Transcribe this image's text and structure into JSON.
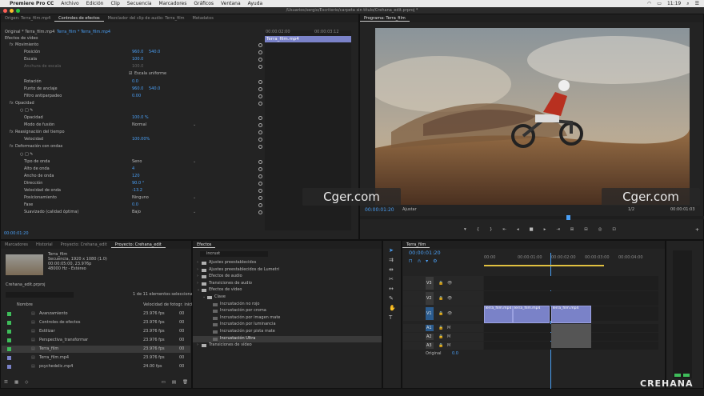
{
  "menubar": {
    "app": "Premiere Pro CC",
    "items": [
      "Archivo",
      "Edición",
      "Clip",
      "Secuencia",
      "Marcadores",
      "Gráficos",
      "Ventana",
      "Ayuda"
    ],
    "time": "11:19"
  },
  "window_title": "/Usuarios/sergio/Escritorio/carpeta sin título/Crehana_edit.prproj *",
  "effect_controls": {
    "tabs": [
      "Origen: Terra_film.mp4",
      "Controles de efectos",
      "Mezclador del clip de audio: Terra_film",
      "Metadatos"
    ],
    "clip_path": "Original * Terra_film.mp4",
    "seq_path": "Terra_film * Terra_film.mp4",
    "section": "Efectos de vídeo",
    "rows": [
      {
        "label": "Movimiento",
        "value": "",
        "value2": "",
        "indent": 1,
        "fx": true
      },
      {
        "label": "Posición",
        "value": "960.0",
        "value2": "540.0",
        "indent": 3
      },
      {
        "label": "Escala",
        "value": "100.0",
        "value2": "",
        "indent": 3
      },
      {
        "label": "Anchura de escala",
        "value": "100.0",
        "value2": "",
        "indent": 3,
        "dim": true
      },
      {
        "label": "",
        "value": "Escala uniforme",
        "value2": "",
        "indent": 3,
        "check": true
      },
      {
        "label": "Rotación",
        "value": "0.0",
        "value2": "",
        "indent": 3
      },
      {
        "label": "Punto de anclaje",
        "value": "960.0",
        "value2": "540.0",
        "indent": 3
      },
      {
        "label": "Filtro antiparpadeo",
        "value": "0.00",
        "value2": "",
        "indent": 3
      },
      {
        "label": "Opacidad",
        "value": "",
        "value2": "",
        "indent": 1,
        "fx": true
      },
      {
        "label": "",
        "value": "",
        "value2": "",
        "indent": 2,
        "shapes": true
      },
      {
        "label": "Opacidad",
        "value": "100.0 %",
        "value2": "",
        "indent": 3
      },
      {
        "label": "Modo de fusión",
        "value": "Normal",
        "value2": "",
        "indent": 3,
        "dropdown": true
      },
      {
        "label": "Reasignación del tiempo",
        "value": "",
        "value2": "",
        "indent": 1,
        "fx": true
      },
      {
        "label": "Velocidad",
        "value": "100.00%",
        "value2": "",
        "indent": 3
      },
      {
        "label": "Deformación con ondas",
        "value": "",
        "value2": "",
        "indent": 1,
        "fx": true
      },
      {
        "label": "",
        "value": "",
        "value2": "",
        "indent": 2,
        "shapes": true
      },
      {
        "label": "Tipo de onda",
        "value": "Seno",
        "value2": "",
        "indent": 3,
        "dropdown": true
      },
      {
        "label": "Alto de onda",
        "value": "4",
        "value2": "",
        "indent": 3
      },
      {
        "label": "Ancho de onda",
        "value": "120",
        "value2": "",
        "indent": 3
      },
      {
        "label": "Dirección",
        "value": "90.0 °",
        "value2": "",
        "indent": 3
      },
      {
        "label": "Velocidad de onda",
        "value": "-13.2",
        "value2": "",
        "indent": 3
      },
      {
        "label": "Posicionamiento",
        "value": "Ninguno",
        "value2": "",
        "indent": 3,
        "dropdown": true
      },
      {
        "label": "Fase",
        "value": "0.0",
        "value2": "",
        "indent": 3
      },
      {
        "label": "Suavizado (calidad óptima)",
        "value": "Bajo",
        "value2": "",
        "indent": 3,
        "dropdown": true
      }
    ],
    "timecode": "00:00:01:20",
    "mini_timeline": {
      "ticks": [
        "00:00:02:00",
        "00:00:03:12"
      ],
      "clip_label": "Terra_film.mp4"
    }
  },
  "program": {
    "tab": "Programa: Terra_film",
    "timecode": "00:00:01:20",
    "fit": "Ajustar",
    "quality": "1/2",
    "duration": "00:00:01:03"
  },
  "watermarks": [
    "Cger.com",
    "Cger.com"
  ],
  "project": {
    "tabs": [
      "Marcadores",
      "Historial",
      "Proyecto: Crehana_edit",
      "Proyecto: Crehana_edit"
    ],
    "clip_name": "Terra_film",
    "clip_info": "Secuencia, 1920 x 1080 (1.0)",
    "clip_info2": "00:00:05:00, 23.976p",
    "clip_info3": "48000 Hz - Estéreo",
    "project_file": "Crehana_edit.prproj",
    "count": "1 de 11 elementos seleccionados",
    "col_name": "Nombre",
    "col_rate": "Velocidad de fotogr. inicio",
    "items": [
      {
        "name": "Avanzamiento",
        "rate": "23.976 fps",
        "end": "00",
        "color": "#3ebd5a"
      },
      {
        "name": "Controles de efectos",
        "rate": "23.976 fps",
        "end": "00",
        "color": "#3ebd5a"
      },
      {
        "name": "Estilizar",
        "rate": "23.976 fps",
        "end": "00",
        "color": "#3ebd5a"
      },
      {
        "name": "Perspectiva_transformar",
        "rate": "23.976 fps",
        "end": "00",
        "color": "#3ebd5a"
      },
      {
        "name": "Terra_film",
        "rate": "23.976 fps",
        "end": "00",
        "color": "#3ebd5a",
        "selected": true
      },
      {
        "name": "Terra_film.mp4",
        "rate": "23.976 fps",
        "end": "00",
        "color": "#7a82c8"
      },
      {
        "name": "psychedelic.mp4",
        "rate": "24.00 fps",
        "end": "00",
        "color": "#7a82c8"
      }
    ]
  },
  "effects": {
    "tab": "Efectos",
    "search": "incrust",
    "items": [
      {
        "label": "Ajustes preestablecidos",
        "indent": 0
      },
      {
        "label": "Ajustes preestablecidos de Lumetri",
        "indent": 0
      },
      {
        "label": "Efectos de audio",
        "indent": 0
      },
      {
        "label": "Transiciones de audio",
        "indent": 0
      },
      {
        "label": "Efectos de vídeo",
        "indent": 0,
        "open": true
      },
      {
        "label": "Clave",
        "indent": 1,
        "open": true
      },
      {
        "label": "Incrustación no rojo",
        "indent": 2,
        "fx": true
      },
      {
        "label": "Incrustación por croma",
        "indent": 2,
        "fx": true
      },
      {
        "label": "Incrustación por imagen mate",
        "indent": 2,
        "fx": true
      },
      {
        "label": "Incrustación por luminancia",
        "indent": 2,
        "fx": true
      },
      {
        "label": "Incrustación por pista mate",
        "indent": 2,
        "fx": true
      },
      {
        "label": "Incrustación Ultra",
        "indent": 2,
        "fx": true,
        "selected": true
      },
      {
        "label": "Transiciones de vídeo",
        "indent": 0
      }
    ]
  },
  "timeline": {
    "tab": "Terra_film",
    "timecode": "00:00:01:20",
    "ruler": [
      "00:00",
      "00:00:01:00",
      "00:00:02:00",
      "00:00:03:00",
      "00:00:04:00"
    ],
    "tracks": [
      "V3",
      "V2",
      "V1",
      "A1",
      "A2",
      "A3"
    ],
    "master": "Original",
    "master_val": "0.0",
    "clips": [
      "Terra_film.mp4",
      "Terra_film.mp4",
      "Terra_film.mp4"
    ]
  },
  "brand": "CREHANA"
}
